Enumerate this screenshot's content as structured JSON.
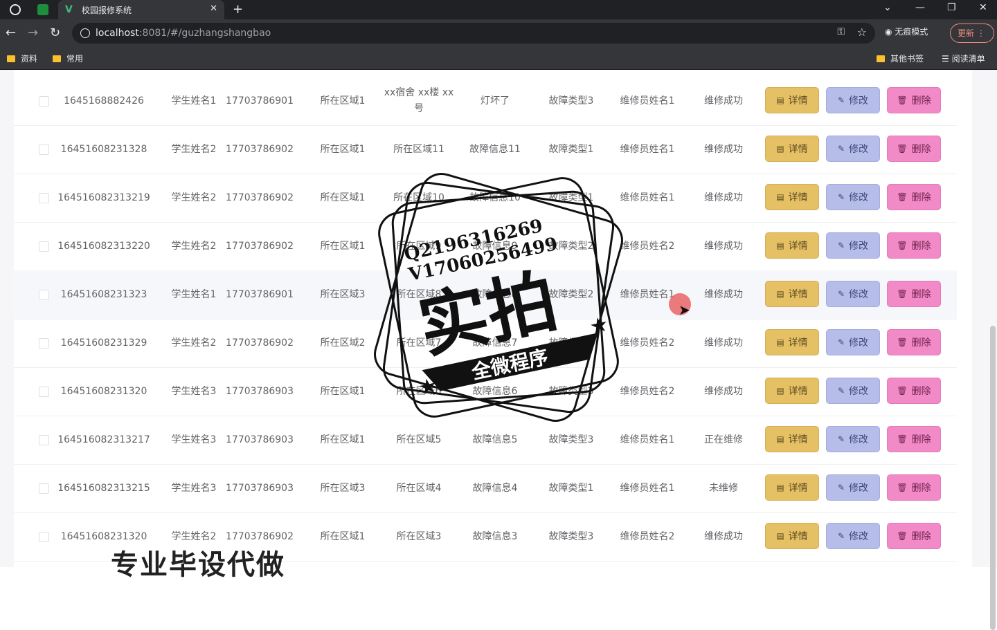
{
  "browser": {
    "tab_title": "校园报修系统",
    "url_host": "localhost",
    "url_rest": ":8081/#/guzhangshangbao",
    "incognito_label": "无痕模式",
    "update_label": "更新",
    "bookmarks": [
      "资料",
      "常用"
    ],
    "bookmarks_right": [
      "其他书签",
      "阅读清单"
    ]
  },
  "table": {
    "buttons": {
      "detail": "详情",
      "edit": "修改",
      "delete": "删除"
    },
    "rows": [
      {
        "id": "1645168882426",
        "name": "学生姓名1",
        "phone": "17703786901",
        "area": "所在区域1",
        "location": "xx宿舍 xx楼 xx号",
        "fault": "灯坏了",
        "type": "故障类型3",
        "repairer": "维修员姓名1",
        "status": "维修成功"
      },
      {
        "id": "16451608231328",
        "name": "学生姓名2",
        "phone": "17703786902",
        "area": "所在区域1",
        "location": "所在区域11",
        "fault": "故障信息11",
        "type": "故障类型1",
        "repairer": "维修员姓名1",
        "status": "维修成功"
      },
      {
        "id": "164516082313219",
        "name": "学生姓名2",
        "phone": "17703786902",
        "area": "所在区域1",
        "location": "所在区域10",
        "fault": "故障信息10",
        "type": "故障类型1",
        "repairer": "维修员姓名1",
        "status": "维修成功"
      },
      {
        "id": "164516082313220",
        "name": "学生姓名2",
        "phone": "17703786902",
        "area": "所在区域1",
        "location": "所在区域9",
        "fault": "故障信息9",
        "type": "故障类型2",
        "repairer": "维修员姓名2",
        "status": "维修成功"
      },
      {
        "id": "16451608231323",
        "name": "学生姓名1",
        "phone": "17703786901",
        "area": "所在区域3",
        "location": "所在区域8",
        "fault": "故障信息8",
        "type": "故障类型2",
        "repairer": "维修员姓名1",
        "status": "维修成功"
      },
      {
        "id": "16451608231329",
        "name": "学生姓名2",
        "phone": "17703786902",
        "area": "所在区域2",
        "location": "所在区域7",
        "fault": "故障信息7",
        "type": "故障类型1",
        "repairer": "维修员姓名2",
        "status": "维修成功"
      },
      {
        "id": "16451608231320",
        "name": "学生姓名3",
        "phone": "17703786903",
        "area": "所在区域1",
        "location": "所在区域6",
        "fault": "故障信息6",
        "type": "故障类型3",
        "repairer": "维修员姓名2",
        "status": "维修成功"
      },
      {
        "id": "164516082313217",
        "name": "学生姓名3",
        "phone": "17703786903",
        "area": "所在区域1",
        "location": "所在区域5",
        "fault": "故障信息5",
        "type": "故障类型3",
        "repairer": "维修员姓名1",
        "status": "正在维修"
      },
      {
        "id": "164516082313215",
        "name": "学生姓名3",
        "phone": "17703786903",
        "area": "所在区域3",
        "location": "所在区域4",
        "fault": "故障信息4",
        "type": "故障类型1",
        "repairer": "维修员姓名1",
        "status": "未维修"
      },
      {
        "id": "16451608231320",
        "name": "学生姓名2",
        "phone": "17703786902",
        "area": "所在区域1",
        "location": "所在区域3",
        "fault": "故障信息3",
        "type": "故障类型3",
        "repairer": "维修员姓名2",
        "status": "维修成功"
      }
    ]
  },
  "watermark": {
    "qq": "Q2196316269",
    "wechat": "V17060256499",
    "main": "实拍",
    "sub": "全微程序",
    "banner": "专业毕设代做"
  }
}
